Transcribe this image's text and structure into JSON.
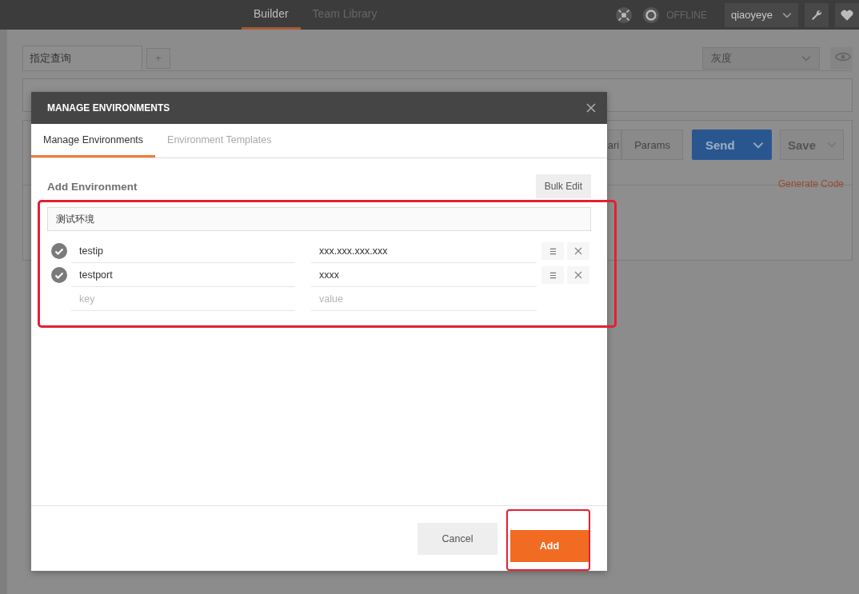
{
  "topbar": {
    "nav_tabs": [
      {
        "label": "Builder",
        "selected": true
      },
      {
        "label": "Team Library",
        "selected": false
      }
    ],
    "status": "OFFLINE",
    "user": "qiaoyeye"
  },
  "request_tabs": [
    {
      "label": "指定查询",
      "selected": true
    }
  ],
  "add_tab": "+",
  "environment_select": "灰度",
  "request_bar": {
    "buttons": [
      "ari",
      "Params"
    ],
    "send": "Send",
    "save": "Save",
    "generate_code": "Generate Code"
  },
  "dialog": {
    "title": "MANAGE ENVIRONMENTS",
    "tabs": [
      {
        "label": "Manage Environments",
        "selected": true
      },
      {
        "label": "Environment Templates",
        "selected": false
      }
    ],
    "section_title": "Add Environment",
    "bulk_edit": "Bulk Edit",
    "name": "测试环境",
    "variables": [
      {
        "key": "testip",
        "value": "xxx.xxx.xxx.xxx",
        "enabled": true
      },
      {
        "key": "testport",
        "value": "xxxx",
        "enabled": true
      }
    ],
    "new_variable": {
      "key_placeholder": "key",
      "value_placeholder": "value"
    },
    "buttons": [
      {
        "label": "Cancel",
        "kind": "secondary"
      },
      {
        "label": "Add",
        "kind": "primary"
      }
    ]
  }
}
